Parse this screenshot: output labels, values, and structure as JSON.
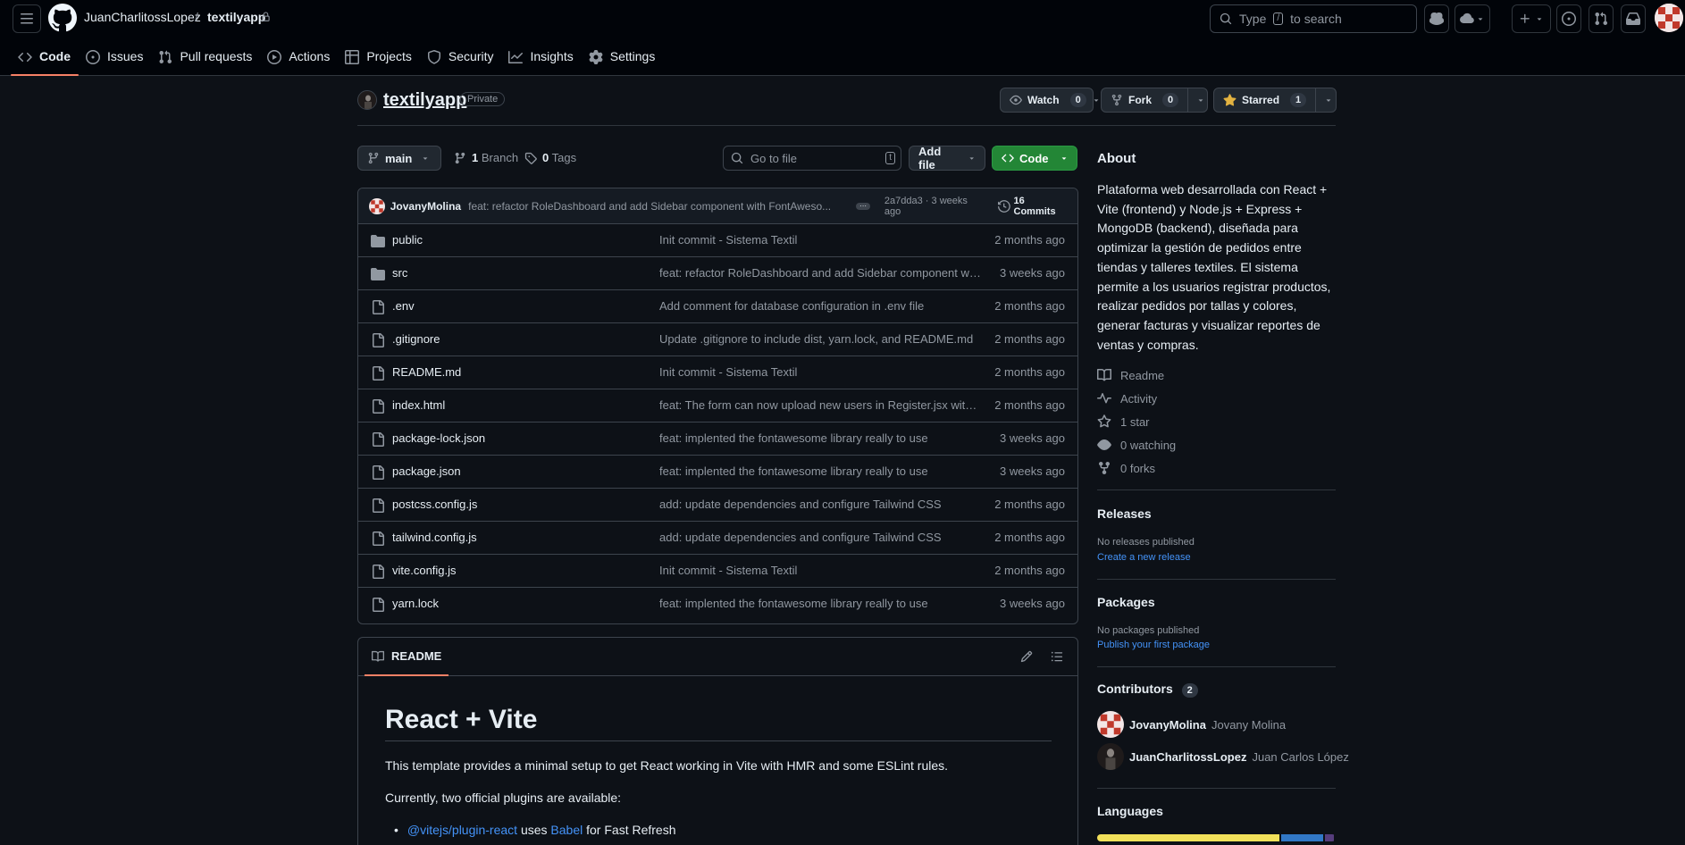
{
  "header": {
    "owner": "JuanCharlitossLopez",
    "separator": "/",
    "repo": "textilyapp",
    "search_prefix": "Type",
    "search_key": "/",
    "search_suffix": "to search"
  },
  "tabs": [
    {
      "label": "Code"
    },
    {
      "label": "Issues"
    },
    {
      "label": "Pull requests"
    },
    {
      "label": "Actions"
    },
    {
      "label": "Projects"
    },
    {
      "label": "Security"
    },
    {
      "label": "Insights"
    },
    {
      "label": "Settings"
    }
  ],
  "repo": {
    "name": "textilyapp",
    "visibility": "Private",
    "watch_label": "Watch",
    "watch_count": "0",
    "fork_label": "Fork",
    "fork_count": "0",
    "star_label": "Starred",
    "star_count": "1"
  },
  "toolbar": {
    "branch": "main",
    "branches_count": "1",
    "branches_label": "Branch",
    "tags_count": "0",
    "tags_label": "Tags",
    "goto_placeholder": "Go to file",
    "goto_key": "t",
    "add_file": "Add file",
    "code": "Code"
  },
  "last_commit": {
    "author": "JovanyMolina",
    "message": "feat: refactor RoleDashboard and add Sidebar component with FontAweso...",
    "sha_time": "2a7dda3 · 3 weeks ago",
    "commits": "16 Commits"
  },
  "files": [
    {
      "name": "public",
      "type": "folder",
      "message": "Init commit - Sistema Textil",
      "date": "2 months ago"
    },
    {
      "name": "src",
      "type": "folder",
      "message": "feat: refactor RoleDashboard and add Sidebar component wi...",
      "date": "3 weeks ago"
    },
    {
      "name": ".env",
      "type": "file",
      "message": "Add comment for database configuration in .env file",
      "date": "2 months ago"
    },
    {
      "name": ".gitignore",
      "type": "file",
      "message": "Update .gitignore to include dist, yarn.lock, and README.md",
      "date": "2 months ago"
    },
    {
      "name": "README.md",
      "type": "file",
      "message": "Init commit - Sistema Textil",
      "date": "2 months ago"
    },
    {
      "name": "index.html",
      "type": "file",
      "message": "feat: The form can now upload new users in Register.jsx with...",
      "date": "2 months ago"
    },
    {
      "name": "package-lock.json",
      "type": "file",
      "message": "feat: implented the fontawesome library really to use",
      "date": "3 weeks ago"
    },
    {
      "name": "package.json",
      "type": "file",
      "message": "feat: implented the fontawesome library really to use",
      "date": "3 weeks ago"
    },
    {
      "name": "postcss.config.js",
      "type": "file",
      "message": "add: update dependencies and configure Tailwind CSS",
      "date": "2 months ago"
    },
    {
      "name": "tailwind.config.js",
      "type": "file",
      "message": "add: update dependencies and configure Tailwind CSS",
      "date": "2 months ago"
    },
    {
      "name": "vite.config.js",
      "type": "file",
      "message": "Init commit - Sistema Textil",
      "date": "2 months ago"
    },
    {
      "name": "yarn.lock",
      "type": "file",
      "message": "feat: implented the fontawesome library really to use",
      "date": "3 weeks ago"
    }
  ],
  "readme": {
    "tab": "README",
    "title": "React + Vite",
    "p1": "This template provides a minimal setup to get React working in Vite with HMR and some ESLint rules.",
    "p2": "Currently, two official plugins are available:",
    "li_link1": "@vitejs/plugin-react",
    "li_mid": "uses",
    "li_link2": "Babel",
    "li_end": "for Fast Refresh"
  },
  "about": {
    "heading": "About",
    "description": "Plataforma web desarrollada con React + Vite (frontend) y Node.js + Express + MongoDB (backend), diseñada para optimizar la gestión de pedidos entre tiendas y talleres textiles. El sistema permite a los usuarios registrar productos, realizar pedidos por tallas y colores, generar facturas y visualizar reportes de ventas y compras.",
    "readme": "Readme",
    "activity": "Activity",
    "stars": "1 star",
    "watching": "0 watching",
    "forks": "0 forks"
  },
  "releases": {
    "heading": "Releases",
    "empty": "No releases published",
    "link": "Create a new release"
  },
  "packages": {
    "heading": "Packages",
    "empty": "No packages published",
    "link": "Publish your first package"
  },
  "contributors": {
    "heading": "Contributors",
    "count": "2",
    "list": [
      {
        "login": "JovanyMolina",
        "name": "Jovany Molina"
      },
      {
        "login": "JuanCharlitossLopez",
        "name": "Juan Carlos López..."
      }
    ]
  },
  "languages": {
    "heading": "Languages",
    "bar": [
      {
        "color": "#f1e05a",
        "share": 0.78
      },
      {
        "color": "#3178c6",
        "share": 0.18
      },
      {
        "color": "#563d7c",
        "share": 0.04
      }
    ]
  },
  "colors": {
    "accent_green": "#238636",
    "tab_underline": "#f78166",
    "link": "#4493f8"
  }
}
